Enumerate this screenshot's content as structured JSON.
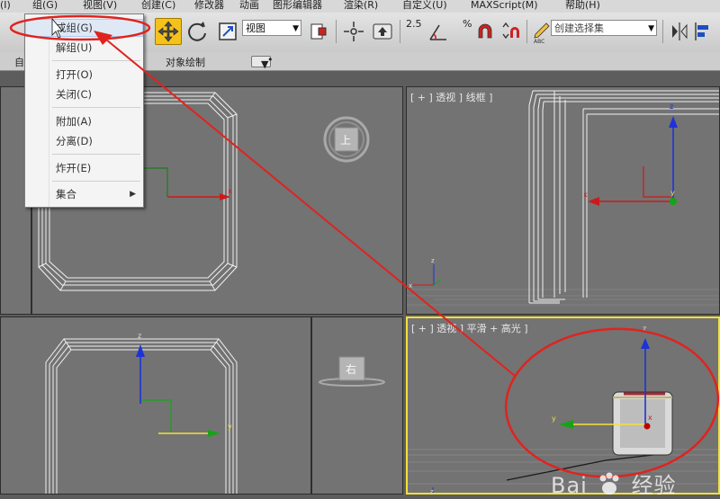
{
  "menubar": {
    "items": [
      "(I)",
      "组(G)",
      "视图(V)",
      "创建(C)",
      "修改器",
      "动画",
      "图形编辑器",
      "渲染(R)",
      "自定义(U)",
      "MAXScript(M)",
      "帮助(H)"
    ]
  },
  "toolbar": {
    "view_combo": "视图",
    "snap_angle": "2.5",
    "snap_percent": "%",
    "selection_set_placeholder": "创建选择集"
  },
  "ribbon": {
    "left_label": "自",
    "object_paint": "对象绘制"
  },
  "dropdown": {
    "items": [
      {
        "label": "成组(G)",
        "highlighted": true
      },
      {
        "label": "解组(U)"
      },
      {
        "label": "打开(O)"
      },
      {
        "label": "关闭(C)"
      },
      {
        "label": "附加(A)"
      },
      {
        "label": "分离(D)"
      },
      {
        "label": "炸开(E)"
      },
      {
        "label": "集合",
        "submenu": true
      }
    ]
  },
  "viewports": {
    "top_left": {
      "label": "",
      "cube_label": "上"
    },
    "top_right": {
      "label": "[ + ] 透视 ] 线框 ]"
    },
    "bottom_left": {
      "label": "",
      "cube_label": "右"
    },
    "bottom_right": {
      "label": "[ + ] 透视 ] 平滑 + 高光 ]",
      "active": true
    }
  },
  "axes": {
    "x": "x",
    "y": "y",
    "z": "z"
  },
  "colors": {
    "annotation": "#e0231f",
    "active_viewport_border": "#f2e13a",
    "active_tool": "#f4c21b",
    "axis_x": "#cc1a1a",
    "axis_y": "#17a317",
    "axis_z": "#1d33d6"
  },
  "watermark": {
    "brand": "Bai",
    "suffix": "经验"
  }
}
